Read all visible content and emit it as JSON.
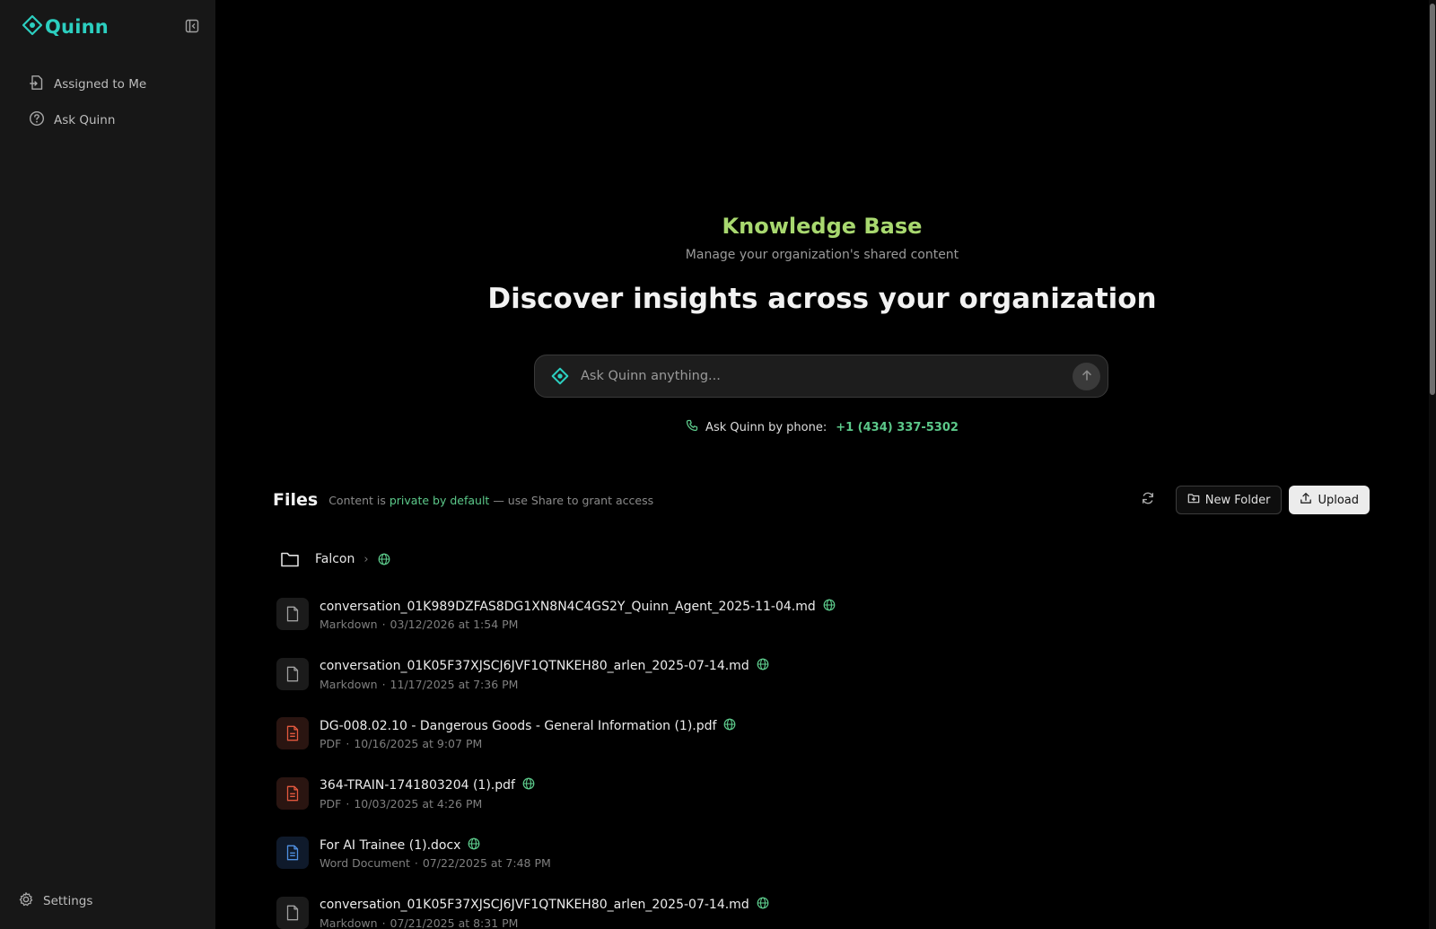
{
  "app": {
    "name": "Quinn"
  },
  "sidebar": {
    "items": [
      {
        "label": "Assigned to Me",
        "icon": "file-arrow-icon"
      },
      {
        "label": "Ask Quinn",
        "icon": "help-circle-icon"
      }
    ],
    "settings_label": "Settings"
  },
  "hero": {
    "title": "Knowledge Base",
    "subtitle": "Manage your organization's shared content",
    "headline": "Discover insights across your organization"
  },
  "search": {
    "placeholder": "Ask Quinn anything..."
  },
  "phone": {
    "label": "Ask Quinn by phone:",
    "number": "+1 (434) 337-5302"
  },
  "files": {
    "title": "Files",
    "note_prefix": "Content is",
    "note_accent": "private by default",
    "note_suffix": "— use Share to grant access",
    "new_folder_label": "New Folder",
    "upload_label": "Upload",
    "folder": {
      "name": "Falcon"
    },
    "items": [
      {
        "name": "conversation_01K989DZFAS8DG1XN8N4C4GS2Y_Quinn_Agent_2025-11-04.md",
        "type": "Markdown",
        "date": "03/12/2026 at 1:54 PM",
        "kind": "md"
      },
      {
        "name": "conversation_01K05F37XJSCJ6JVF1QTNKEH80_arlen_2025-07-14.md",
        "type": "Markdown",
        "date": "11/17/2025 at 7:36 PM",
        "kind": "md"
      },
      {
        "name": "DG-008.02.10 - Dangerous Goods - General Information (1).pdf",
        "type": "PDF",
        "date": "10/16/2025 at 9:07 PM",
        "kind": "pdf"
      },
      {
        "name": "364-TRAIN-1741803204 (1).pdf",
        "type": "PDF",
        "date": "10/03/2025 at 4:26 PM",
        "kind": "pdf"
      },
      {
        "name": "For AI Trainee (1).docx",
        "type": "Word Document",
        "date": "07/22/2025 at 7:48 PM",
        "kind": "doc"
      },
      {
        "name": "conversation_01K05F37XJSCJ6JVF1QTNKEH80_arlen_2025-07-14.md",
        "type": "Markdown",
        "date": "07/21/2025 at 8:31 PM",
        "kind": "md"
      }
    ]
  },
  "colors": {
    "brand": "#2ccfc0",
    "title_green": "#a8d86f",
    "accent_green": "#5cc98a",
    "pdf_red": "#e2583e",
    "doc_blue": "#4f8fe0"
  }
}
